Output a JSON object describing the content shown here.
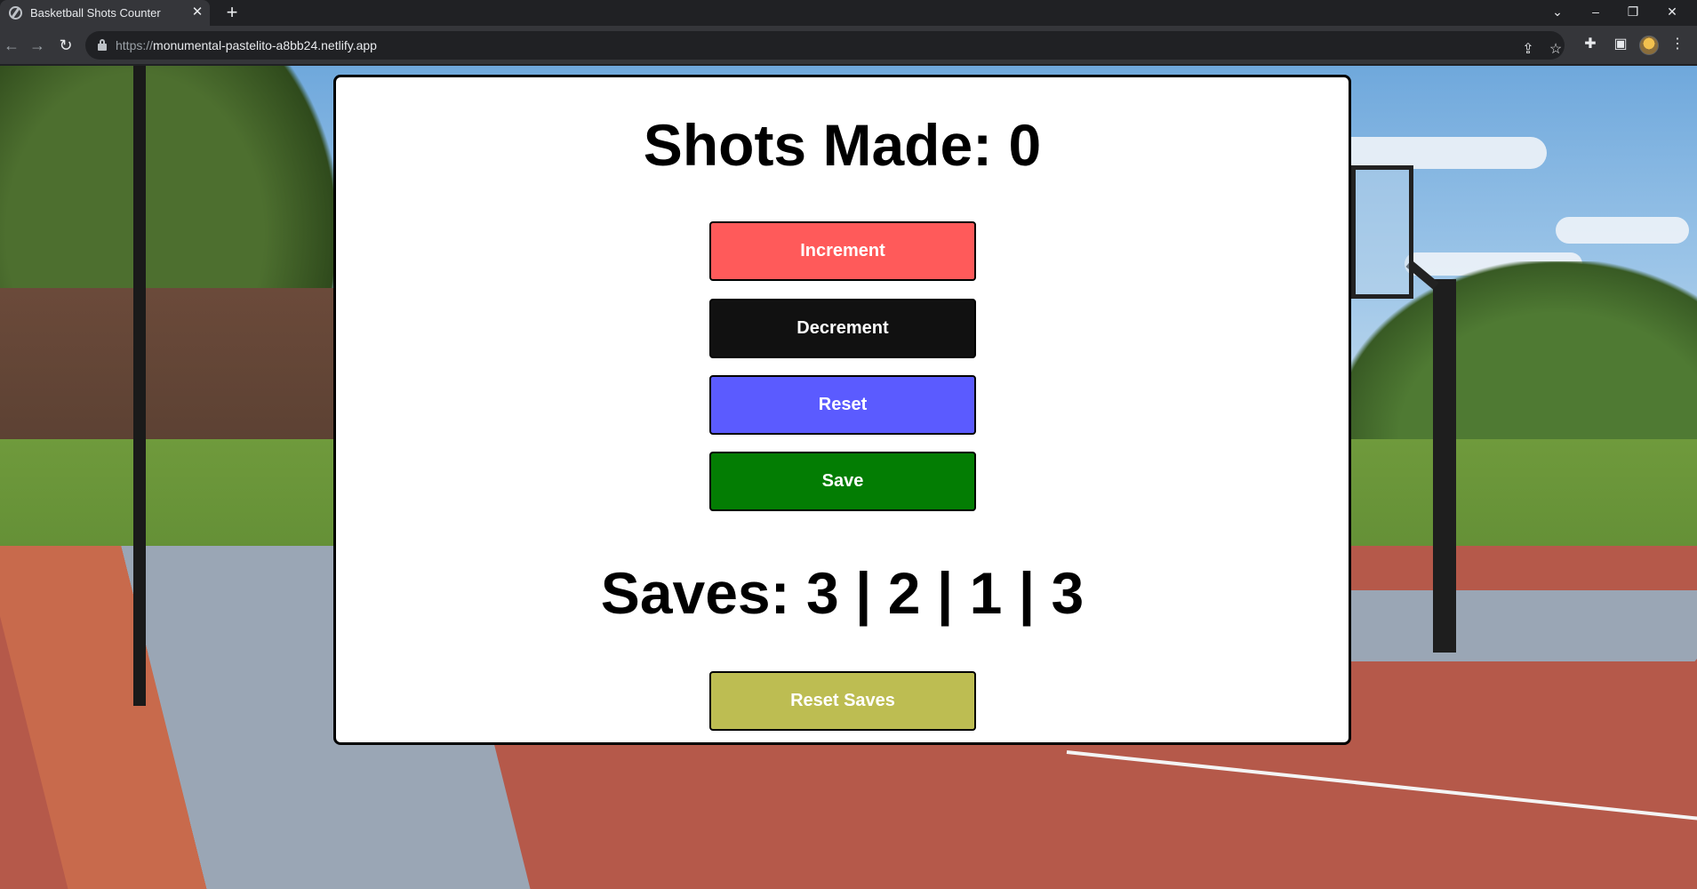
{
  "browser": {
    "tab_title": "Basketball Shots Counter",
    "url_scheme": "https://",
    "url_host": "monumental-pastelito-a8bb24.netlify.app"
  },
  "icons": {
    "favicon": "globe-icon",
    "tab_close": "close-icon",
    "new_tab": "plus-icon",
    "back": "arrow-left-icon",
    "forward": "arrow-right-icon",
    "reload": "reload-icon",
    "lock": "lock-icon",
    "share": "share-icon",
    "bookmark": "star-icon",
    "extensions": "puzzle-icon",
    "side_panel": "side-panel-icon",
    "menu": "kebab-menu-icon"
  },
  "counter": {
    "headline": "Shots Made: 0",
    "increment_label": "Increment",
    "decrement_label": "Decrement",
    "reset_label": "Reset",
    "save_label": "Save",
    "saves_text": "Saves: 3 | 2 | 1 | 3",
    "reset_saves_label": "Reset Saves"
  },
  "colors": {
    "increment": "#ff5a5a",
    "decrement": "#111111",
    "reset": "#5b5bff",
    "save": "#037d03",
    "reset_saves": "#bdbd52"
  }
}
